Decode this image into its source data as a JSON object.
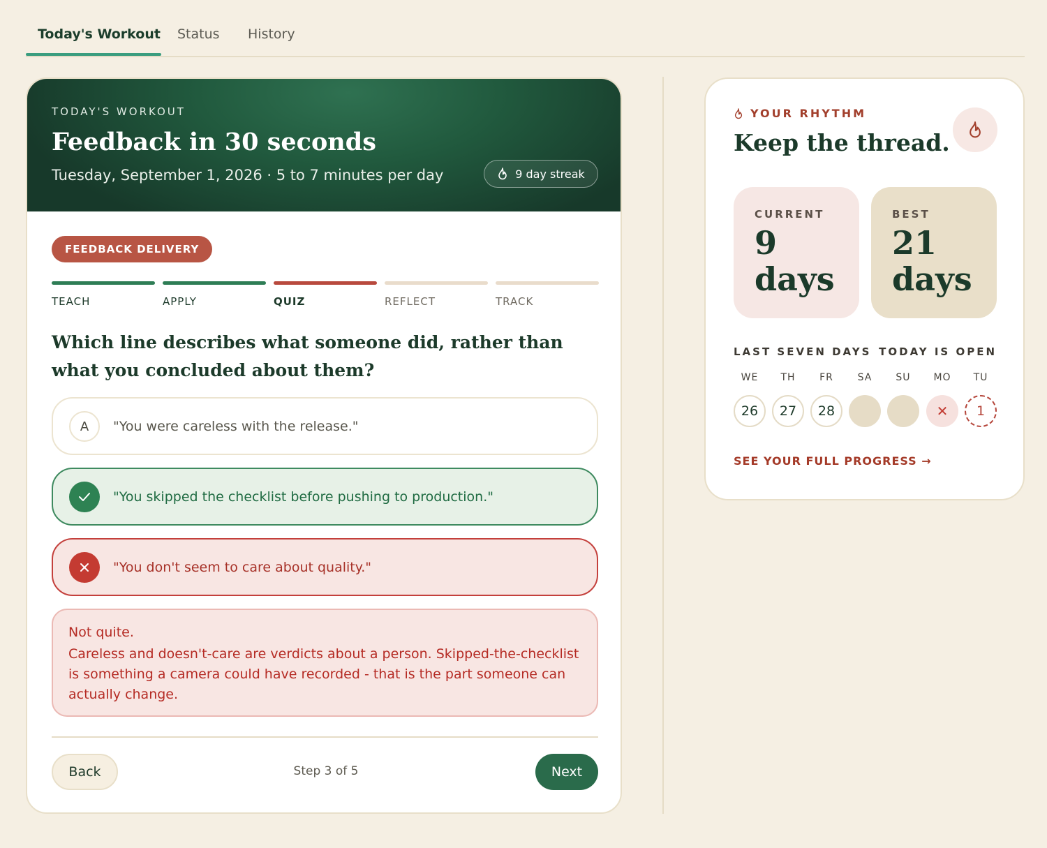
{
  "tabs": [
    {
      "label": "Today's Workout",
      "active": true
    },
    {
      "label": "Status",
      "active": false
    },
    {
      "label": "History",
      "active": false
    }
  ],
  "workout": {
    "eyebrow": "TODAY'S WORKOUT",
    "title": "Feedback in 30 seconds",
    "subtitle": "Tuesday, September 1, 2026 · 5 to 7 minutes per day",
    "streak_label": "9 day streak",
    "topic": "FEEDBACK DELIVERY",
    "steps": [
      {
        "label": "TEACH",
        "state": "done"
      },
      {
        "label": "APPLY",
        "state": "done"
      },
      {
        "label": "QUIZ",
        "state": "current"
      },
      {
        "label": "REFLECT",
        "state": "upcoming"
      },
      {
        "label": "TRACK",
        "state": "upcoming"
      }
    ],
    "question": "Which line describes what someone did, rather than what you concluded about them?",
    "options": [
      {
        "marker": "A",
        "text": "\"You were careless with the release.\"",
        "state": "neutral"
      },
      {
        "marker": "check-icon",
        "text": "\"You skipped the checklist before pushing to production.\"",
        "state": "correct"
      },
      {
        "marker": "x-icon",
        "text": "\"You don't seem to care about quality.\"",
        "state": "wrong"
      }
    ],
    "feedback": {
      "title": "Not quite.",
      "body": "Careless and doesn't-care are verdicts about a person. Skipped-the-checklist is something a camera could have recorded - that is the part someone can actually change."
    },
    "back_label": "Back",
    "step_count": "Step 3 of 5",
    "next_label": "Next"
  },
  "rhythm": {
    "eyebrow": "YOUR RHYTHM",
    "title": "Keep the thread.",
    "current_label": "CURRENT",
    "current_value": "9",
    "current_unit": "days",
    "best_label": "BEST",
    "best_value": "21",
    "best_unit": "days",
    "week_label": "LAST SEVEN DAYS",
    "today_label": "TODAY IS OPEN",
    "days": [
      {
        "label": "WE",
        "value": "26",
        "state": "done"
      },
      {
        "label": "TH",
        "value": "27",
        "state": "done"
      },
      {
        "label": "FR",
        "value": "28",
        "state": "done"
      },
      {
        "label": "SA",
        "value": "",
        "state": "empty"
      },
      {
        "label": "SU",
        "value": "",
        "state": "empty"
      },
      {
        "label": "MO",
        "value": "✕",
        "state": "missed"
      },
      {
        "label": "TU",
        "value": "1",
        "state": "today"
      }
    ],
    "link": "SEE YOUR FULL PROGRESS →"
  },
  "colors": {
    "background": "#f5efe3",
    "brand_green": "#2a6b4b",
    "accent_red": "#b85544",
    "tab_underline": "#3a9d7f"
  }
}
